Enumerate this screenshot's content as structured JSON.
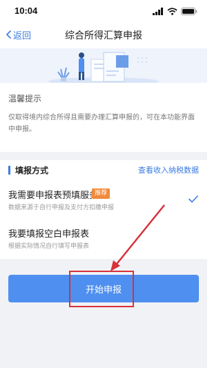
{
  "status_bar": {
    "time": "10:04"
  },
  "nav": {
    "back_label": "返回",
    "title": "综合所得汇算申报"
  },
  "tip": {
    "title": "温馨提示",
    "body": "仅取得境内综合所得且需要办理汇算申报的，可在本功能界面中申报。"
  },
  "method": {
    "title": "填报方式",
    "link_label": "查看收入纳税数据",
    "options": [
      {
        "title": "我需要申报表预填服务",
        "badge": "推荐",
        "desc": "数据来源于自行申报及支付方扣缴申报",
        "selected": true
      },
      {
        "title": "我要填报空白申报表",
        "desc": "根据实际情况自行填写申报表",
        "selected": false
      }
    ]
  },
  "start_button": {
    "label": "开始申报"
  },
  "colors": {
    "accent": "#3a7be0",
    "button": "#4f8ff0",
    "badge": "#f08a3c",
    "annotation": "#d7323a"
  },
  "icons": [
    "signal-icon",
    "wifi-icon",
    "battery-icon",
    "chevron-left-icon",
    "checkmark-icon"
  ]
}
